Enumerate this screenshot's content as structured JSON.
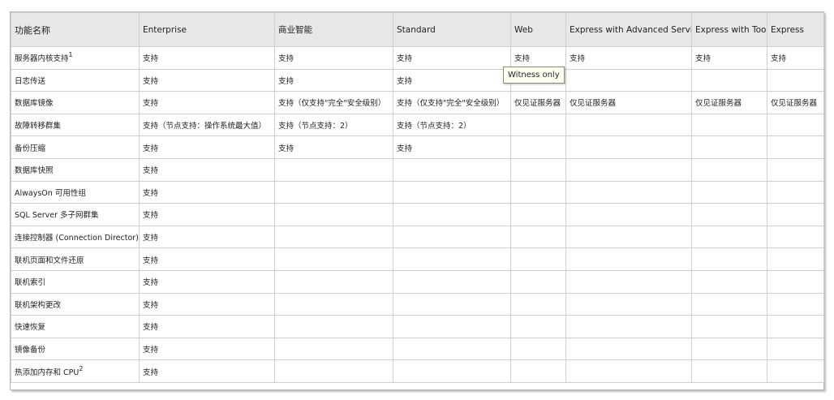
{
  "columns": [
    "功能名称",
    "Enterprise",
    "商业智能",
    "Standard",
    "Web",
    "Express with Advanced Services",
    "Express with Tools",
    "Express"
  ],
  "rows": [
    {
      "name": "服务器内核支持",
      "sup": "1",
      "cells": [
        "支持",
        "支持",
        "支持",
        "支持",
        "支持",
        "支持",
        "支持"
      ]
    },
    {
      "name": "日志传送",
      "sup": "",
      "cells": [
        "支持",
        "支持",
        "支持",
        "",
        "",
        "",
        ""
      ]
    },
    {
      "name": "数据库镜像",
      "sup": "",
      "cells": [
        "支持",
        "支持（仅支持\"完全\"安全级别）",
        "支持（仅支持\"完全\"安全级别）",
        "仅见证服务器",
        "仅见证服务器",
        "仅见证服务器",
        "仅见证服务器"
      ]
    },
    {
      "name": "故障转移群集",
      "sup": "",
      "cells": [
        "支持（节点支持：操作系统最大值）",
        "支持（节点支持：2）",
        "支持（节点支持：2）",
        "",
        "",
        "",
        ""
      ]
    },
    {
      "name": "备份压缩",
      "sup": "",
      "cells": [
        "支持",
        "支持",
        "支持",
        "",
        "",
        "",
        ""
      ]
    },
    {
      "name": "数据库快照",
      "sup": "",
      "cells": [
        "支持",
        "",
        "",
        "",
        "",
        "",
        ""
      ]
    },
    {
      "name": "AlwaysOn 可用性组",
      "sup": "",
      "cells": [
        "支持",
        "",
        "",
        "",
        "",
        "",
        ""
      ]
    },
    {
      "name": "SQL Server 多子网群集",
      "sup": "",
      "cells": [
        "支持",
        "",
        "",
        "",
        "",
        "",
        ""
      ]
    },
    {
      "name": "连接控制器 (Connection Director)",
      "sup": "",
      "cells": [
        "支持",
        "",
        "",
        "",
        "",
        "",
        ""
      ]
    },
    {
      "name": "联机页面和文件还原",
      "sup": "",
      "cells": [
        "支持",
        "",
        "",
        "",
        "",
        "",
        ""
      ]
    },
    {
      "name": "联机索引",
      "sup": "",
      "cells": [
        "支持",
        "",
        "",
        "",
        "",
        "",
        ""
      ]
    },
    {
      "name": "联机架构更改",
      "sup": "",
      "cells": [
        "支持",
        "",
        "",
        "",
        "",
        "",
        ""
      ]
    },
    {
      "name": "快速恢复",
      "sup": "",
      "cells": [
        "支持",
        "",
        "",
        "",
        "",
        "",
        ""
      ]
    },
    {
      "name": "镜像备份",
      "sup": "",
      "cells": [
        "支持",
        "",
        "",
        "",
        "",
        "",
        ""
      ]
    },
    {
      "name": "热添加内存和 CPU",
      "sup": "2",
      "cells": [
        "支持",
        "",
        "",
        "",
        "",
        "",
        ""
      ]
    }
  ],
  "tooltip": {
    "text": "Witness only"
  }
}
